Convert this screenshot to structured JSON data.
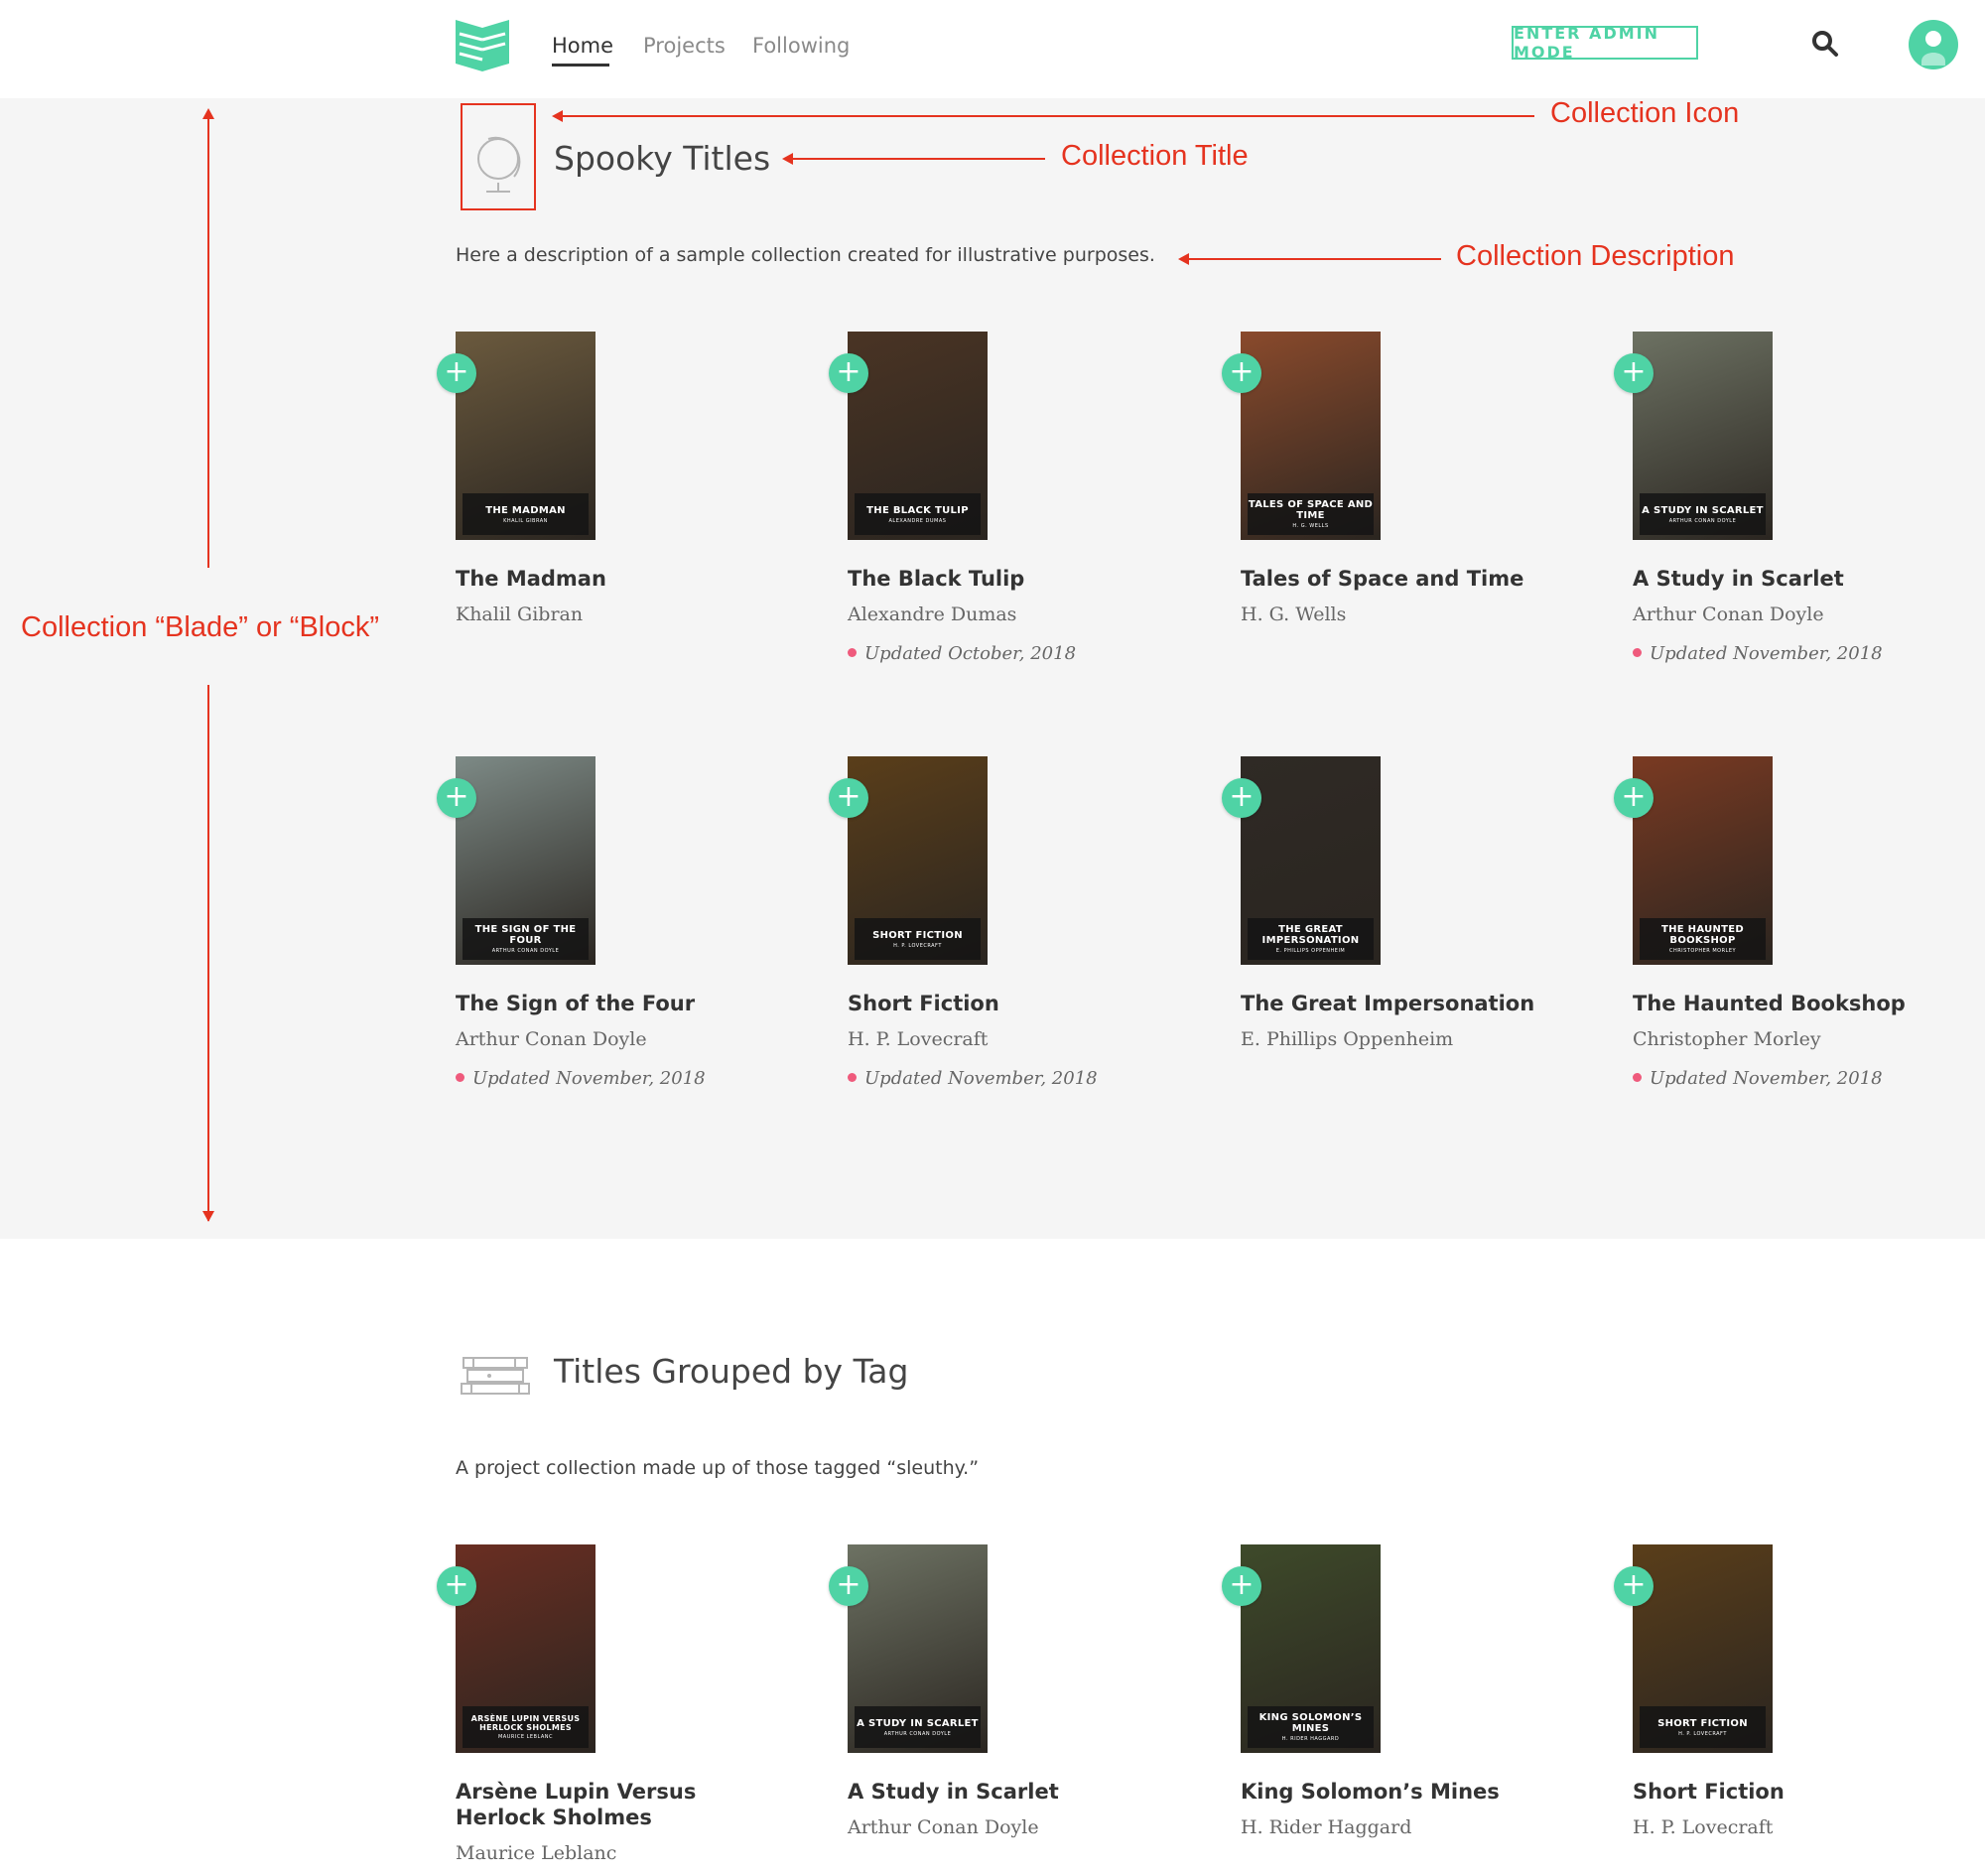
{
  "nav": {
    "home": "Home",
    "projects": "Projects",
    "following": "Following",
    "admin_button": "ENTER ADMIN MODE"
  },
  "annotations": {
    "collection_icon": "Collection Icon",
    "collection_title": "Collection Title",
    "collection_description": "Collection Description",
    "collection_blade": "Collection “Blade” or “Block”"
  },
  "collection1": {
    "title": "Spooky Titles",
    "description": "Here a description of a sample collection created for illustrative purposes.",
    "books": [
      {
        "title": "The Madman",
        "author": "Khalil Gibran",
        "updated": "",
        "cover_title": "THE MADMAN",
        "cover_author": "KHALIL GIBRAN",
        "cover_color": "#6b5a3e"
      },
      {
        "title": "The Black Tulip",
        "author": "Alexandre Dumas",
        "updated": "Updated October, 2018",
        "cover_title": "THE BLACK TULIP",
        "cover_author": "ALEXANDRE DUMAS",
        "cover_color": "#4a3424"
      },
      {
        "title": "Tales of Space and Time",
        "author": "H. G. Wells",
        "updated": "",
        "cover_title": "TALES OF SPACE AND TIME",
        "cover_author": "H. G. WELLS",
        "cover_color": "#8a4a2c"
      },
      {
        "title": "A Study in Scarlet",
        "author": "Arthur Conan Doyle",
        "updated": "Updated November, 2018",
        "cover_title": "A STUDY IN SCARLET",
        "cover_author": "ARTHUR CONAN DOYLE",
        "cover_color": "#6d7263"
      },
      {
        "title": "The Sign of the Four",
        "author": "Arthur Conan Doyle",
        "updated": "Updated November, 2018",
        "cover_title": "THE SIGN OF THE FOUR",
        "cover_author": "ARTHUR CONAN DOYLE",
        "cover_color": "#7d8a86"
      },
      {
        "title": "Short Fiction",
        "author": "H. P. Lovecraft",
        "updated": "Updated November, 2018",
        "cover_title": "SHORT FICTION",
        "cover_author": "H. P. LOVECRAFT",
        "cover_color": "#5a3e1a"
      },
      {
        "title": "The Great Impersonation",
        "author": "E. Phillips Oppenheim",
        "updated": "",
        "cover_title": "THE GREAT IMPERSONATION",
        "cover_author": "E. PHILLIPS OPPENHEIM",
        "cover_color": "#2f2a25"
      },
      {
        "title": "The Haunted Bookshop",
        "author": "Christopher Morley",
        "updated": "Updated November, 2018",
        "cover_title": "THE HAUNTED BOOKSHOP",
        "cover_author": "CHRISTOPHER MORLEY",
        "cover_color": "#7a3a22"
      }
    ]
  },
  "collection2": {
    "title": "Titles Grouped by Tag",
    "description": "A project collection made up of those tagged “sleuthy.”",
    "books": [
      {
        "title": "Arsène Lupin Versus Herlock Sholmes",
        "author": "Maurice Leblanc",
        "cover_title": "ARSÈNE LUPIN VERSUS HERLOCK SHOLMES",
        "cover_author": "MAURICE LEBLANC",
        "cover_color": "#6a2e22"
      },
      {
        "title": "A Study in Scarlet",
        "author": "Arthur Conan Doyle",
        "cover_title": "A STUDY IN SCARLET",
        "cover_author": "ARTHUR CONAN DOYLE",
        "cover_color": "#6d7263"
      },
      {
        "title": "King Solomon’s Mines",
        "author": "H. Rider Haggard",
        "cover_title": "KING SOLOMON’S MINES",
        "cover_author": "H. RIDER HAGGARD",
        "cover_color": "#3e4a2a"
      },
      {
        "title": "Short Fiction",
        "author": "H. P. Lovecraft",
        "cover_title": "SHORT FICTION",
        "cover_author": "H. P. LOVECRAFT",
        "cover_color": "#5a3e1a"
      }
    ]
  },
  "colors": {
    "accent": "#4fd3a5",
    "annotation": "#e5331f",
    "update_dot": "#ef5a7c"
  }
}
